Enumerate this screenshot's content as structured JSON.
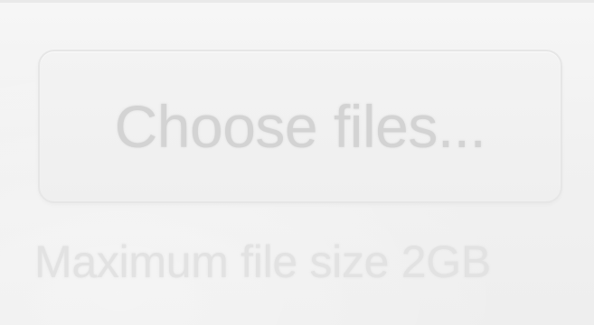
{
  "upload": {
    "button_label": "Choose files...",
    "hint": "Maximum file size 2GB"
  }
}
